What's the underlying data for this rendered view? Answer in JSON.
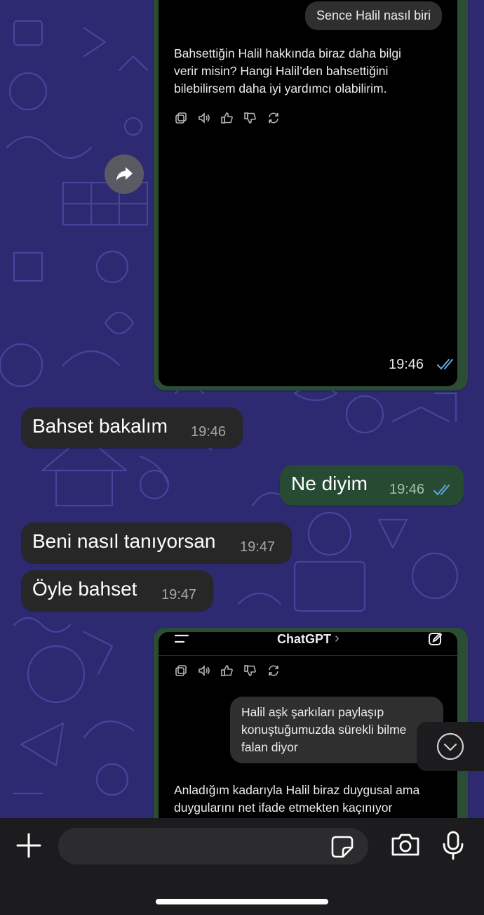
{
  "screenshot_top": {
    "user_prompt": "Sence Halil nasıl biri",
    "assistant_lines": [
      "Bahsettiğin Halil hakkında biraz daha bilgi",
      "verir misin? Hangi Halil’den bahsettiğini",
      "bilebilirsem daha iyi yardımcı olabilirim."
    ],
    "time": "19:46"
  },
  "messages": [
    {
      "text": "Bahset bakalım",
      "time": "19:46",
      "direction": "in"
    },
    {
      "text": "Ne diyim",
      "time": "19:46",
      "direction": "out"
    },
    {
      "text": "Beni nasıl tanıyorsan",
      "time": "19:47",
      "direction": "in"
    },
    {
      "text": "Öyle bahset",
      "time": "19:47",
      "direction": "in"
    }
  ],
  "screenshot_bottom": {
    "app_title": "ChatGPT",
    "title_chevron": "›",
    "user_lines": [
      "Halil aşk şarkıları paylaşıp",
      "konuştuğumuzda sürekli bilme",
      "falan diyor"
    ],
    "assistant_lines": [
      "Anladığım kadarıyla Halil biraz duygusal ama",
      "duygularını net ifade etmekten kaçınıyor"
    ]
  },
  "colors": {
    "wallpaper": "#2d2a72",
    "incoming_bubble": "#272727",
    "outgoing_bubble": "#264b32",
    "read_ticks": "#5fa8dc",
    "bottom_bar": "#1c1c1e"
  },
  "icons": {
    "forward": "forward-icon",
    "copy": "copy-icon",
    "speaker": "speaker-icon",
    "like": "thumbs-up-icon",
    "dislike": "thumbs-down-icon",
    "regenerate": "regenerate-icon",
    "scroll_down": "chevron-down-icon",
    "attach": "plus-icon",
    "sticker": "sticker-icon",
    "camera": "camera-icon",
    "mic": "microphone-icon",
    "menu": "menu-icon",
    "new_chat": "edit-icon"
  }
}
